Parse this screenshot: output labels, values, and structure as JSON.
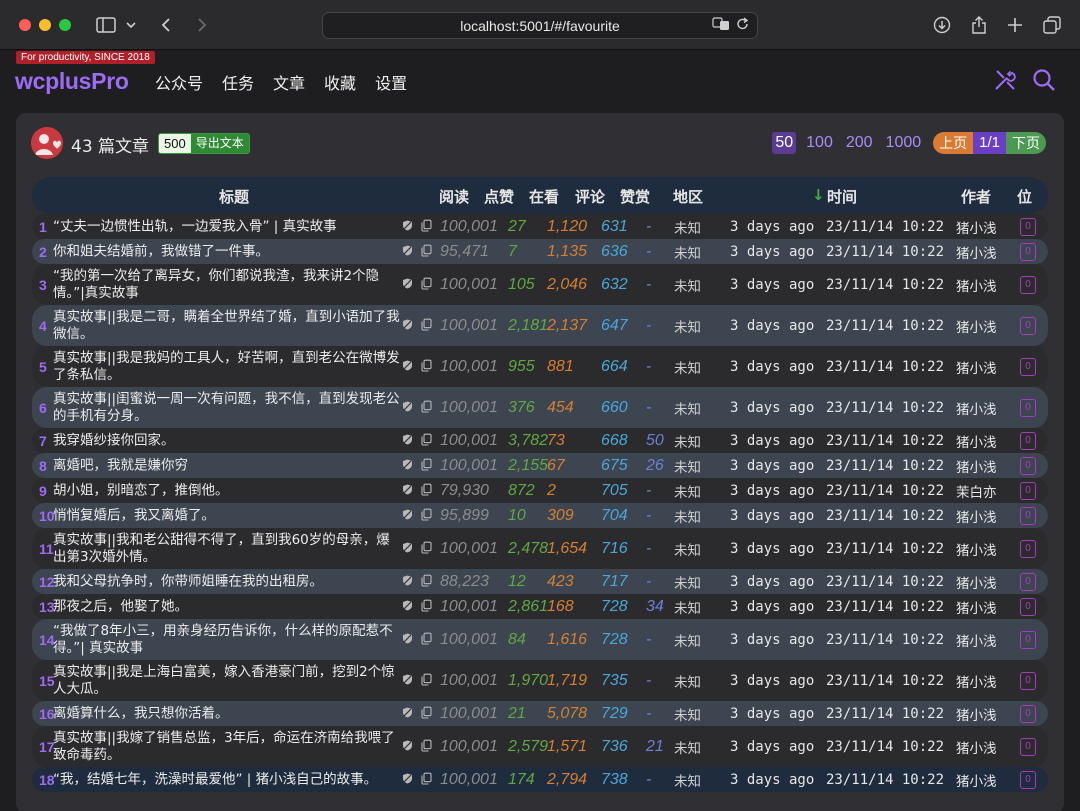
{
  "browser": {
    "url": "localhost:5001/#/favourite"
  },
  "app": {
    "tagline": "For productivity, SINCE 2018",
    "logo": "wcplusPro",
    "nav": [
      "公众号",
      "任务",
      "文章",
      "收藏",
      "设置"
    ]
  },
  "panel": {
    "count_title": "43 篇文章",
    "export_count": "500",
    "export_label": "导出文本",
    "page_sizes": [
      "50",
      "100",
      "200",
      "1000"
    ],
    "active_page_size": "50",
    "prev_label": "上页",
    "page_indicator": "1/1",
    "next_label": "下页"
  },
  "table": {
    "headers": {
      "title": "标题",
      "read": "阅读",
      "like": "点赞",
      "seen": "在看",
      "comment": "评论",
      "reward": "赞赏",
      "region": "地区",
      "time": "时间",
      "author": "作者",
      "position": "位"
    },
    "sort_arrow": "↓",
    "rows": [
      {
        "idx": "1",
        "title": "“丈夫一边惯性出轨，一边爱我入骨” | 真实故事",
        "read": "100,001",
        "like": "27",
        "seen": "1,120",
        "comment": "631",
        "reward": "-",
        "region": "未知",
        "ago": "3 days ago",
        "time": "23/11/14 10:22",
        "author": "猪小浅",
        "pos": "0"
      },
      {
        "idx": "2",
        "title": "你和姐夫结婚前，我做错了一件事。",
        "read": "95,471",
        "like": "7",
        "seen": "1,135",
        "comment": "636",
        "reward": "-",
        "region": "未知",
        "ago": "3 days ago",
        "time": "23/11/14 10:22",
        "author": "猪小浅",
        "pos": "0"
      },
      {
        "idx": "3",
        "title": "“我的第一次给了离异女，你们都说我渣，我来讲2个隐情。”|真实故事",
        "read": "100,001",
        "like": "105",
        "seen": "2,046",
        "comment": "632",
        "reward": "-",
        "region": "未知",
        "ago": "3 days ago",
        "time": "23/11/14 10:22",
        "author": "猪小浅",
        "pos": "0"
      },
      {
        "idx": "4",
        "title": "真实故事||我是二哥，瞒着全世界结了婚，直到小语加了我微信。",
        "read": "100,001",
        "like": "2,181",
        "seen": "2,137",
        "comment": "647",
        "reward": "-",
        "region": "未知",
        "ago": "3 days ago",
        "time": "23/11/14 10:22",
        "author": "猪小浅",
        "pos": "0"
      },
      {
        "idx": "5",
        "title": "真实故事||我是我妈的工具人，好苦啊，直到老公在微博发了条私信。",
        "read": "100,001",
        "like": "955",
        "seen": "881",
        "comment": "664",
        "reward": "-",
        "region": "未知",
        "ago": "3 days ago",
        "time": "23/11/14 10:22",
        "author": "猪小浅",
        "pos": "0"
      },
      {
        "idx": "6",
        "title": "真实故事||闺蜜说一周一次有问题，我不信，直到发现老公的手机有分身。",
        "read": "100,001",
        "like": "376",
        "seen": "454",
        "comment": "660",
        "reward": "-",
        "region": "未知",
        "ago": "3 days ago",
        "time": "23/11/14 10:22",
        "author": "猪小浅",
        "pos": "0"
      },
      {
        "idx": "7",
        "title": "我穿婚纱接你回家。",
        "read": "100,001",
        "like": "3,782",
        "seen": "73",
        "comment": "668",
        "reward": "50",
        "region": "未知",
        "ago": "3 days ago",
        "time": "23/11/14 10:22",
        "author": "猪小浅",
        "pos": "0"
      },
      {
        "idx": "8",
        "title": "离婚吧，我就是嫌你穷",
        "read": "100,001",
        "like": "2,155",
        "seen": "67",
        "comment": "675",
        "reward": "26",
        "region": "未知",
        "ago": "3 days ago",
        "time": "23/11/14 10:22",
        "author": "猪小浅",
        "pos": "0"
      },
      {
        "idx": "9",
        "title": "胡小姐，别暗恋了，推倒他。",
        "read": "79,930",
        "like": "872",
        "seen": "2",
        "comment": "705",
        "reward": "-",
        "region": "未知",
        "ago": "3 days ago",
        "time": "23/11/14 10:22",
        "author": "茉白亦",
        "pos": "0"
      },
      {
        "idx": "10",
        "title": "悄悄复婚后，我又离婚了。",
        "read": "95,899",
        "like": "10",
        "seen": "309",
        "comment": "704",
        "reward": "-",
        "region": "未知",
        "ago": "3 days ago",
        "time": "23/11/14 10:22",
        "author": "猪小浅",
        "pos": "0"
      },
      {
        "idx": "11",
        "title": "真实故事||我和老公甜得不得了，直到我60岁的母亲，爆出第3次婚外情。",
        "read": "100,001",
        "like": "2,478",
        "seen": "1,654",
        "comment": "716",
        "reward": "-",
        "region": "未知",
        "ago": "3 days ago",
        "time": "23/11/14 10:22",
        "author": "猪小浅",
        "pos": "0"
      },
      {
        "idx": "12",
        "title": "我和父母抗争时，你带师姐睡在我的出租房。",
        "read": "88,223",
        "like": "12",
        "seen": "423",
        "comment": "717",
        "reward": "-",
        "region": "未知",
        "ago": "3 days ago",
        "time": "23/11/14 10:22",
        "author": "猪小浅",
        "pos": "0"
      },
      {
        "idx": "13",
        "title": "那夜之后，他娶了她。",
        "read": "100,001",
        "like": "2,861",
        "seen": "168",
        "comment": "728",
        "reward": "34",
        "region": "未知",
        "ago": "3 days ago",
        "time": "23/11/14 10:22",
        "author": "猪小浅",
        "pos": "0"
      },
      {
        "idx": "14",
        "title": "“我做了8年小三，用亲身经历告诉你，什么样的原配惹不得。”| 真实故事",
        "read": "100,001",
        "like": "84",
        "seen": "1,616",
        "comment": "728",
        "reward": "-",
        "region": "未知",
        "ago": "3 days ago",
        "time": "23/11/14 10:22",
        "author": "猪小浅",
        "pos": "0"
      },
      {
        "idx": "15",
        "title": "真实故事||我是上海白富美，嫁入香港豪门前，挖到2个惊人大瓜。",
        "read": "100,001",
        "like": "1,970",
        "seen": "1,719",
        "comment": "735",
        "reward": "-",
        "region": "未知",
        "ago": "3 days ago",
        "time": "23/11/14 10:22",
        "author": "猪小浅",
        "pos": "0"
      },
      {
        "idx": "16",
        "title": "离婚算什么，我只想你活着。",
        "read": "100,001",
        "like": "21",
        "seen": "5,078",
        "comment": "729",
        "reward": "-",
        "region": "未知",
        "ago": "3 days ago",
        "time": "23/11/14 10:22",
        "author": "猪小浅",
        "pos": "0"
      },
      {
        "idx": "17",
        "title": "真实故事||我嫁了销售总监，3年后，命运在济南给我喂了致命毒药。",
        "read": "100,001",
        "like": "2,579",
        "seen": "1,571",
        "comment": "736",
        "reward": "21",
        "region": "未知",
        "ago": "3 days ago",
        "time": "23/11/14 10:22",
        "author": "猪小浅",
        "pos": "0"
      },
      {
        "idx": "18",
        "title": "“我，结婚七年，洗澡时最爱他” | 猪小浅自己的故事。",
        "read": "100,001",
        "like": "174",
        "seen": "2,794",
        "comment": "738",
        "reward": "-",
        "region": "未知",
        "ago": "3 days ago",
        "time": "23/11/14 10:22",
        "author": "猪小浅",
        "pos": "0"
      }
    ]
  },
  "colors": {
    "accent": "#9c6cf3",
    "like": "#5fa843",
    "seen": "#d47f33",
    "comment": "#4ba6d8",
    "reward": "#6e7fd8"
  },
  "icons": [
    "sidebar-icon",
    "chevron-down-icon",
    "back-icon",
    "forward-icon",
    "translate-icon",
    "reload-icon",
    "download-icon",
    "share-icon",
    "plus-icon",
    "tabs-icon",
    "tools-icon",
    "search-icon",
    "shield-icon",
    "copy-icon"
  ]
}
